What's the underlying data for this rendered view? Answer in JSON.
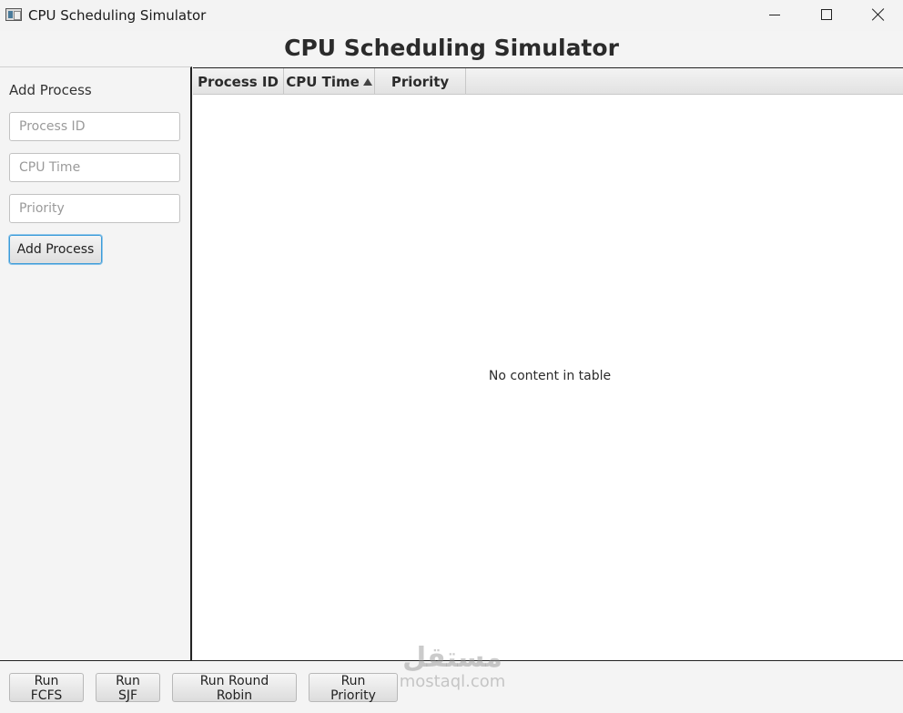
{
  "window": {
    "title": "CPU Scheduling Simulator",
    "icon": "app-window-icon",
    "controls": [
      "minimize-icon",
      "maximize-icon",
      "close-icon"
    ]
  },
  "header": {
    "title": "CPU Scheduling Simulator"
  },
  "sidebar": {
    "title": "Add Process",
    "process_id_placeholder": "Process ID",
    "cpu_time_placeholder": "CPU Time",
    "priority_placeholder": "Priority",
    "add_button_label": "Add Process"
  },
  "table": {
    "columns": [
      {
        "label": "Process ID"
      },
      {
        "label": "CPU Time",
        "sort": "ascending"
      },
      {
        "label": "Priority"
      }
    ],
    "empty_message": "No content in table",
    "rows": []
  },
  "footer": {
    "buttons": [
      {
        "label": "Run FCFS"
      },
      {
        "label": "Run SJF"
      },
      {
        "label": "Run Round Robin"
      },
      {
        "label": "Run Priority"
      }
    ]
  },
  "watermark": {
    "logo": "مستقل",
    "text": "mostaql.com"
  },
  "colors": {
    "accent_focus": "#3b9bd9",
    "panel_bg": "#f4f4f4",
    "table_bg": "#ffffff"
  }
}
